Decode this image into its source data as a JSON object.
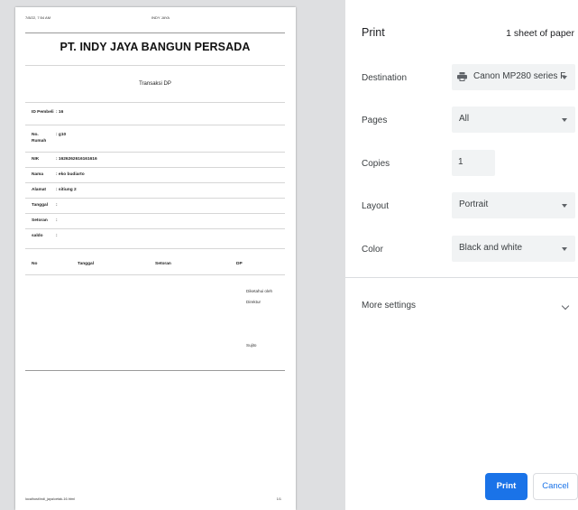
{
  "preview": {
    "header_datetime": "7/8/22, 7:54 AM",
    "header_title": "INDY JAYA",
    "company_name": "PT. INDY JAYA BANGUN PERSADA",
    "doc_title": "Transaksi DP",
    "fields": [
      {
        "label": "ID Pembeli",
        "value": ": 16"
      },
      {
        "label": "No. Rumah",
        "value": ": g10"
      },
      {
        "label": "NIK",
        "value": ": 1626262616161616"
      },
      {
        "label": "Nama",
        "value": ": eko budiarto"
      },
      {
        "label": "Alamat",
        "value": ": sitiung 2"
      },
      {
        "label": "Tanggal",
        "value": ":"
      },
      {
        "label": "Setoran",
        "value": ":"
      },
      {
        "label": "saldo",
        "value": ":"
      }
    ],
    "table_headers": [
      "No",
      "Tanggal",
      "Setoran",
      "DP"
    ],
    "sign_known_by": "Diketahui oleh",
    "sign_role": "Direktur",
    "sign_name": "Sujito",
    "footer_url": "localhost/indi_jaya/cetak-16.html",
    "footer_page": "1/1"
  },
  "panel": {
    "title": "Print",
    "sheet_count": "1 sheet of paper",
    "destination_label": "Destination",
    "destination_value": "Canon MP280 series F",
    "destination_icon": "printer-icon",
    "pages_label": "Pages",
    "pages_value": "All",
    "copies_label": "Copies",
    "copies_value": "1",
    "layout_label": "Layout",
    "layout_value": "Portrait",
    "color_label": "Color",
    "color_value": "Black and white",
    "more_settings": "More settings",
    "print_button": "Print",
    "cancel_button": "Cancel",
    "accent_color": "#1a73e8"
  }
}
